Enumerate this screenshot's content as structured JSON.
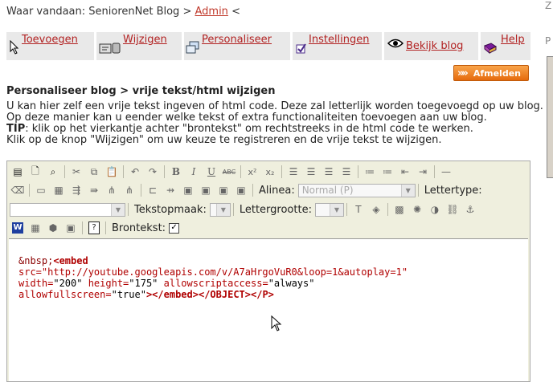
{
  "breadcrumb": {
    "prefix": "Waar vandaan: SeniorenNet Blog >",
    "link": "Admin",
    "suffix": "<"
  },
  "nav": {
    "items": [
      {
        "label": "Toevoegen",
        "icon": "cursor-icon"
      },
      {
        "label": "Wijzigen",
        "icon": "edit-icon"
      },
      {
        "label": "Personaliseer",
        "icon": "windows-icon"
      },
      {
        "label": "Instellingen",
        "icon": "checkbox-icon"
      },
      {
        "label": "Bekijk blog",
        "icon": "eye-icon"
      },
      {
        "label": "Help",
        "icon": "book-icon"
      }
    ]
  },
  "logout_label": "Afmelden",
  "page_title": "Personaliseer blog > vrije tekst/html wijzigen",
  "description": {
    "line1": "U kan hier zelf een vrije tekst ingeven of html code. Deze zal letterlijk worden toegevoegd op uw blog.",
    "line2": "Op deze manier kan u eender welke tekst of extra functionaliteiten toevoegen aan uw blog.",
    "tip_label": "TIP",
    "tip_text": ": klik op het vierkantje achter \"brontekst\" om rechtstreeks in de html code te werken.",
    "line4": "Klik op de knop \"Wijzigen\" om uw keuze te registreren en de vrije tekst te wijzigen."
  },
  "toolbar": {
    "alinea_label": "Alinea:",
    "alinea_value": "Normal (P)",
    "lettertype_label": "Lettertype:",
    "tekstopmaak_label": "Tekstopmaak:",
    "lettergrootte_label": "Lettergrootte:",
    "brontekst_label": "Brontekst:",
    "brontekst_checked": true
  },
  "source": {
    "l1_ent": "&nbsp;",
    "l1_tag": "<embed",
    "l2": "src=\"http://youtube.googleapis.com/v/A7aHrgoVuR0&loop=1&autoplay=1\"",
    "l3_a1": "width=",
    "l3_v1": "\"200\"",
    "l3_a2": " height=",
    "l3_v2": "\"175\"",
    "l3_a3": " allowscriptaccess=",
    "l3_v3": "\"always\"",
    "l4_a1": "allowfullscreen=",
    "l4_v1": "\"true\"",
    "l4_tags": "></embed></OBJECT></P>"
  }
}
